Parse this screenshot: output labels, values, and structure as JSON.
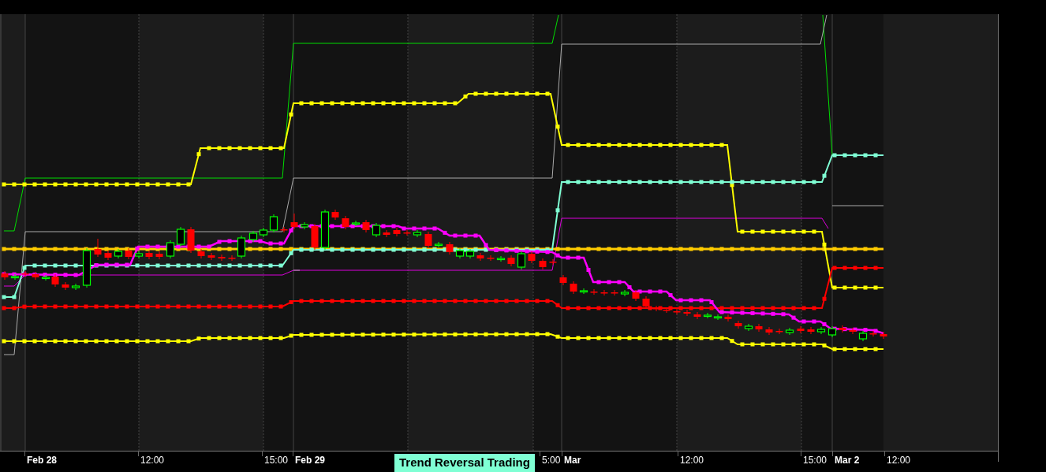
{
  "time_axis": {
    "labels": [
      {
        "text": "Feb 28",
        "kind": "date"
      },
      {
        "text": "12:00",
        "kind": "time"
      },
      {
        "text": "15:00",
        "kind": "time"
      },
      {
        "text": "Feb 29",
        "kind": "date"
      },
      {
        "text": "5:00",
        "kind": "time"
      },
      {
        "text": "Mar",
        "kind": "date"
      },
      {
        "text": "12:00",
        "kind": "time"
      },
      {
        "text": "15:00",
        "kind": "time"
      },
      {
        "text": "Mar 2",
        "kind": "date"
      },
      {
        "text": "12:00",
        "kind": "time"
      }
    ]
  },
  "banner": {
    "text": "Trend Reversal Trading"
  }
}
